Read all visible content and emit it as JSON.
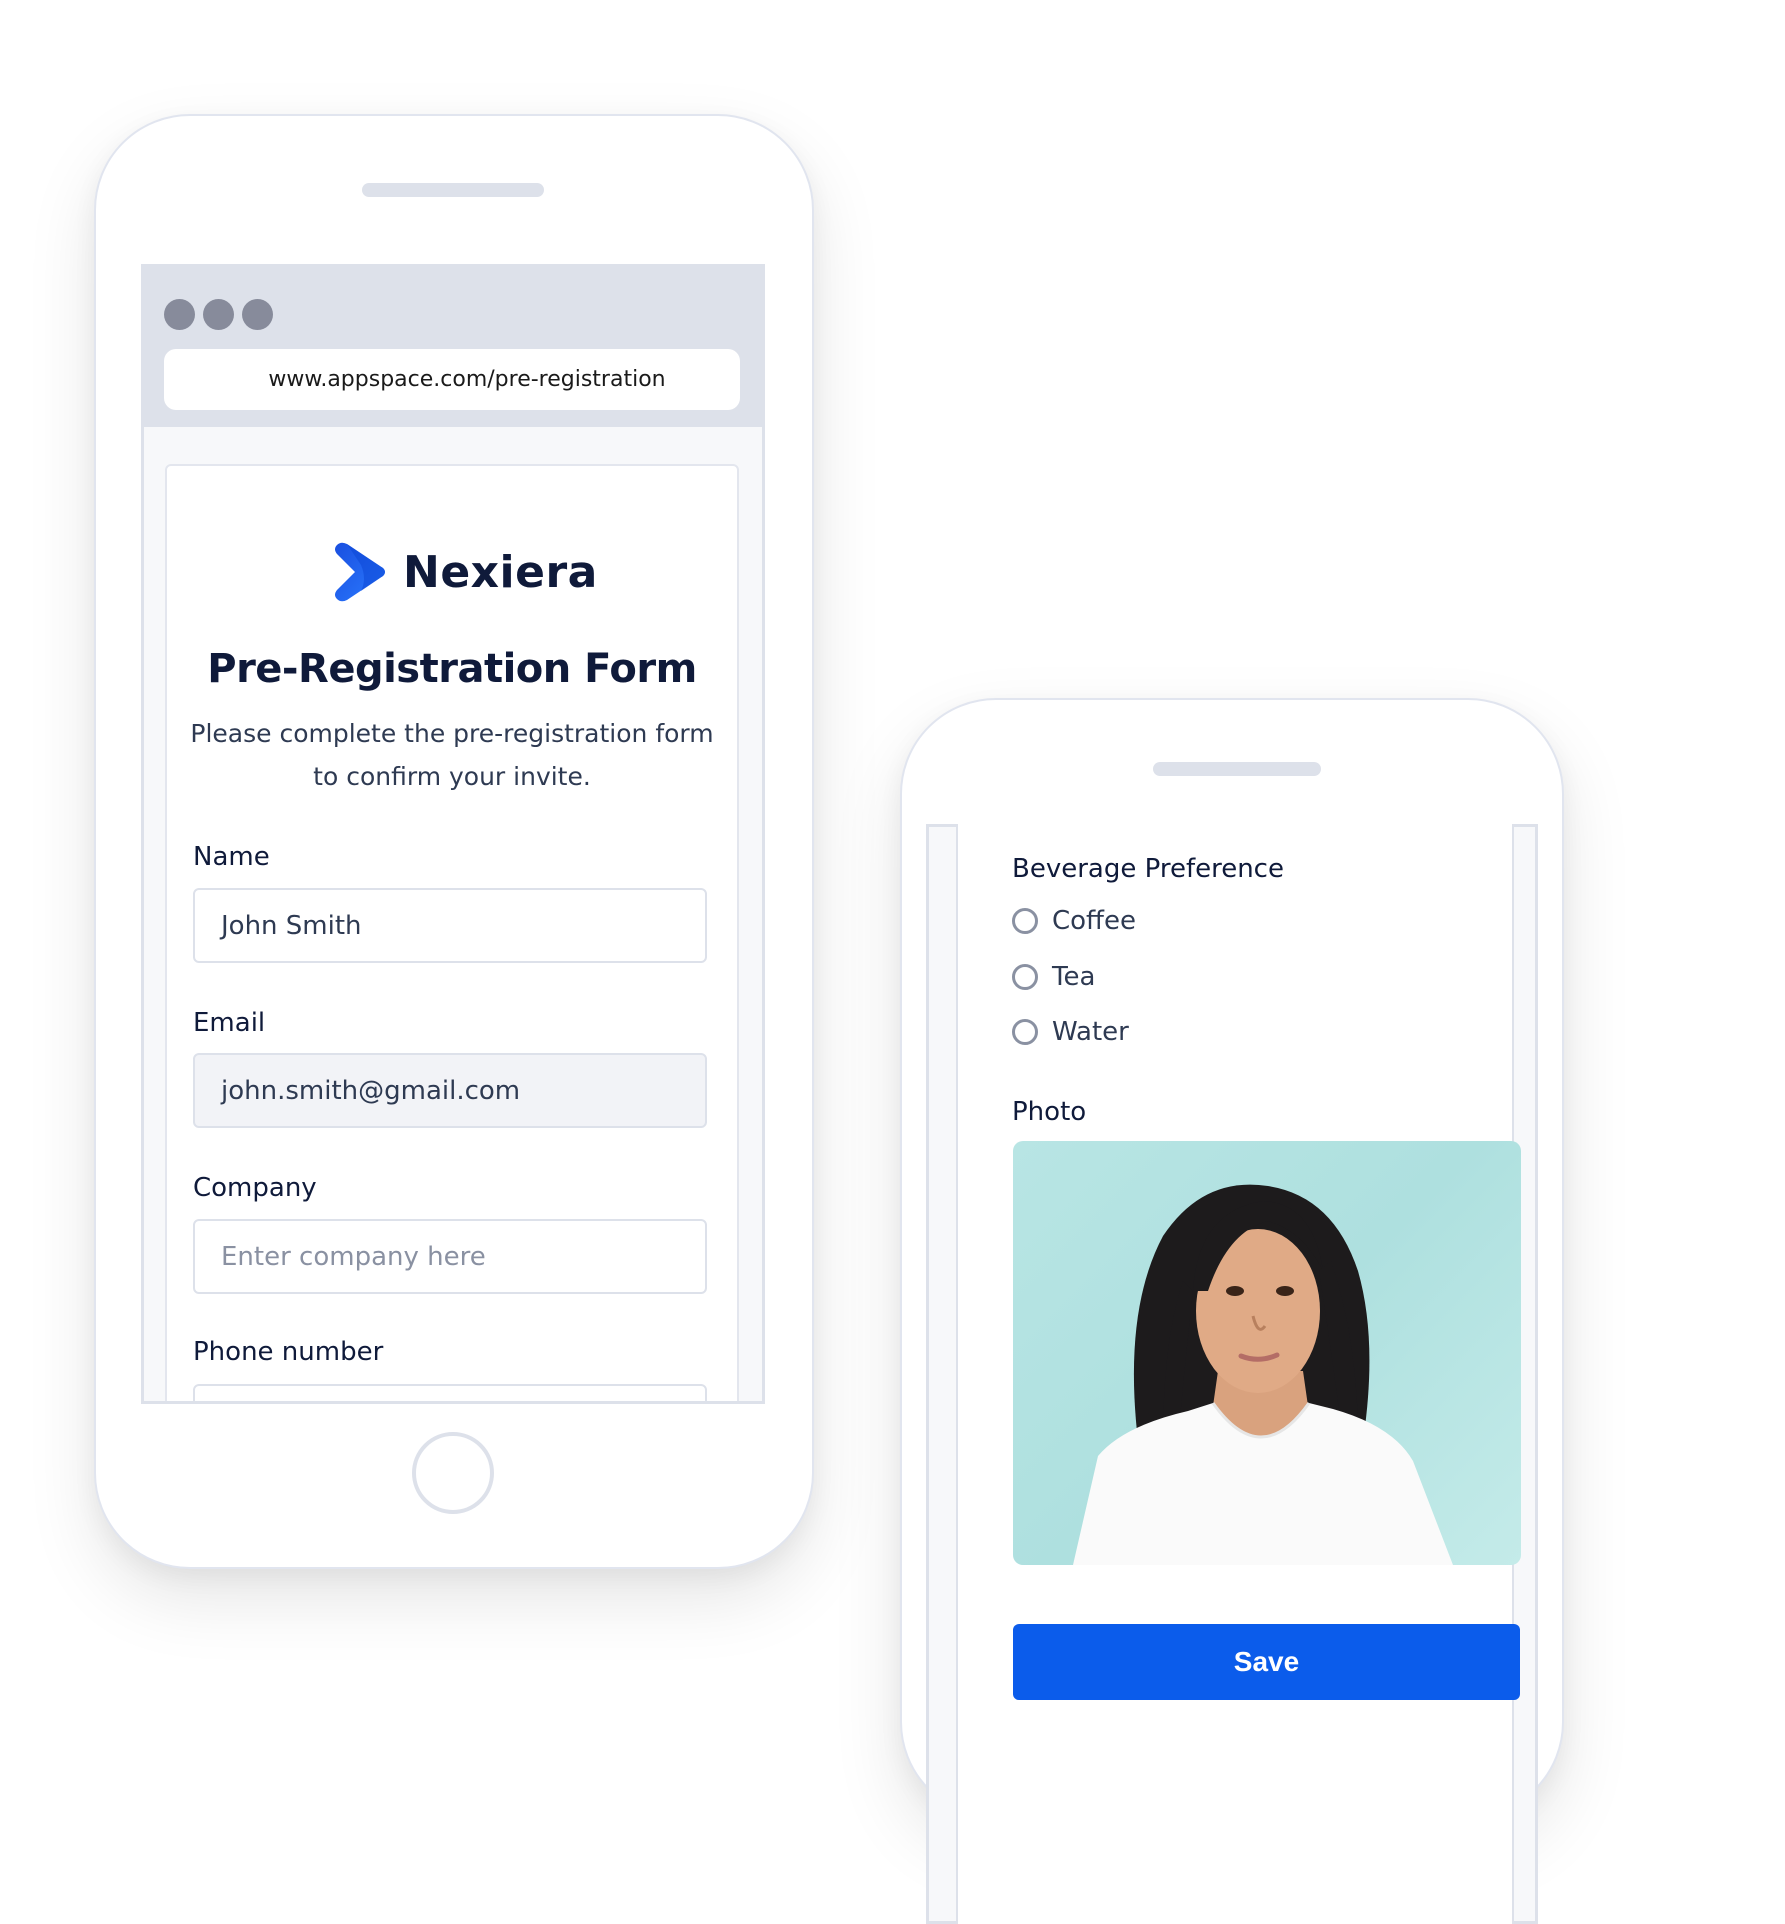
{
  "left_phone": {
    "browser": {
      "window_controls": [
        "dot-1",
        "dot-2",
        "dot-3"
      ],
      "url": "www.appspace.com/pre-registration"
    },
    "form": {
      "brand": {
        "name": "Nexiera",
        "logo_icon": "chevron-right-logo-icon",
        "brand_color": "#1a5ff0"
      },
      "title": "Pre-Registration Form",
      "subtitle": "Please complete the pre-registration form to confirm your invite.",
      "fields": [
        {
          "label": "Name",
          "value": "John Smith",
          "placeholder": ""
        },
        {
          "label": "Email",
          "value": "john.smith@gmail.com",
          "placeholder": "",
          "readonly": true
        },
        {
          "label": "Company",
          "value": "",
          "placeholder": "Enter company here"
        },
        {
          "label": "Phone number",
          "value": "",
          "placeholder": ""
        }
      ]
    }
  },
  "right_phone": {
    "beverage": {
      "label": "Beverage Preference",
      "options": [
        "Coffee",
        "Tea",
        "Water"
      ],
      "selected": null
    },
    "photo": {
      "label": "Photo",
      "alt": "Portrait of a young woman in a white t-shirt against a teal background"
    },
    "save_label": "Save",
    "accent_color": "#0b5ceb"
  }
}
